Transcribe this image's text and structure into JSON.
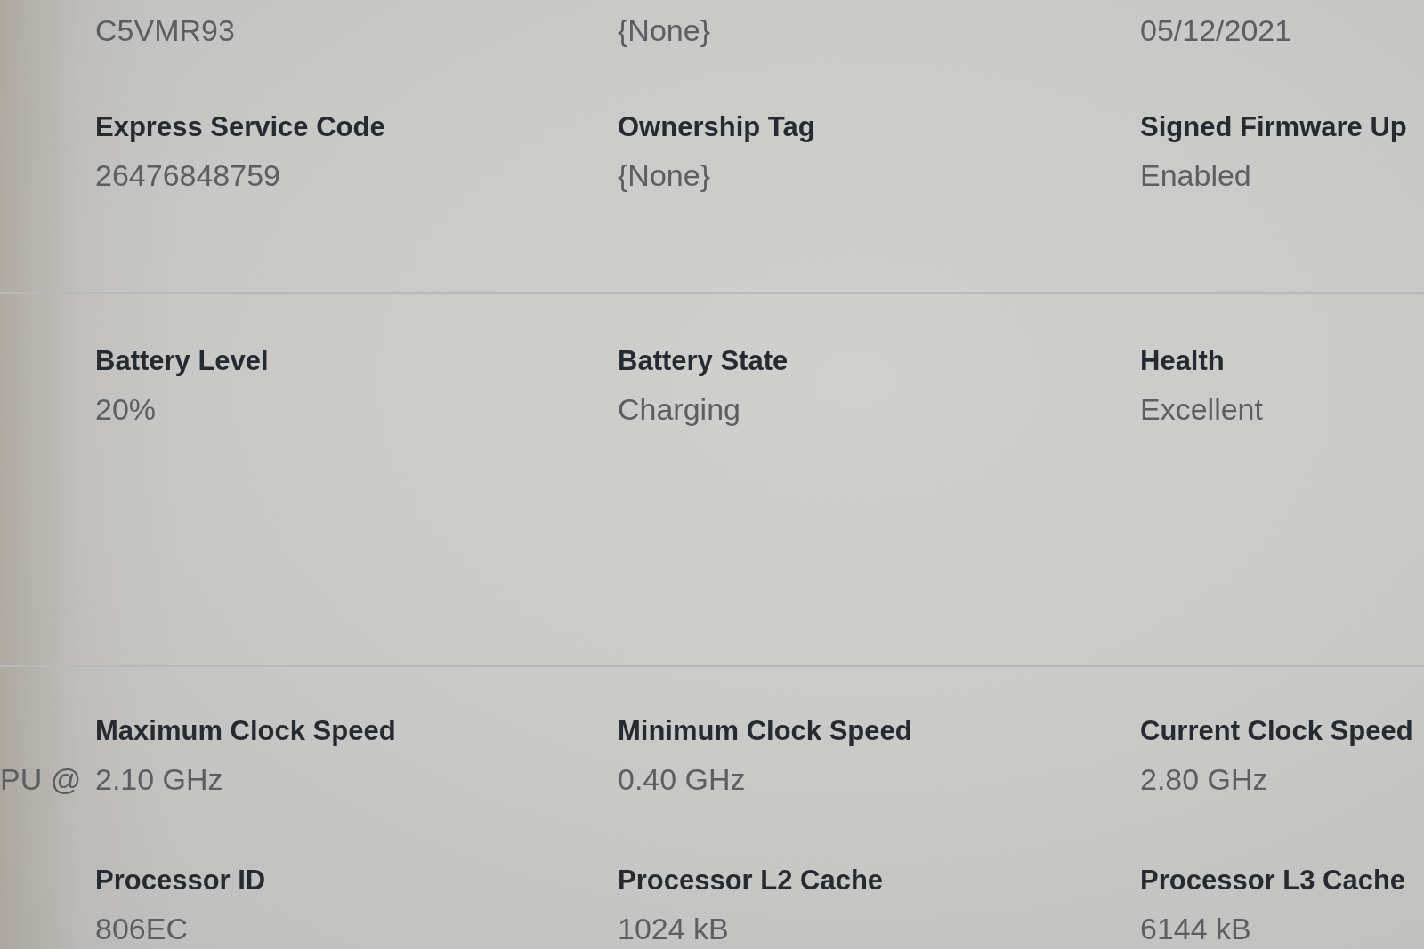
{
  "sections": [
    {
      "rows": [
        {
          "fields": [
            {
              "value": "C5VMR93"
            },
            {
              "value": "{None}"
            },
            {
              "value": "05/12/2021"
            }
          ]
        },
        {
          "fields": [
            {
              "label": "Express Service Code",
              "value": "26476848759"
            },
            {
              "label": "Ownership Tag",
              "value": "{None}"
            },
            {
              "label": "Signed Firmware Up",
              "value": "Enabled"
            }
          ]
        }
      ]
    },
    {
      "rows": [
        {
          "fields": [
            {
              "label": "Battery Level",
              "value": "20%"
            },
            {
              "label": "Battery State",
              "value": "Charging"
            },
            {
              "label": "Health",
              "value": "Excellent"
            }
          ]
        }
      ]
    },
    {
      "rows": [
        {
          "leading": "PU @",
          "fields": [
            {
              "label": "Maximum Clock Speed",
              "value": "2.10 GHz"
            },
            {
              "label": "Minimum Clock Speed",
              "value": "0.40 GHz"
            },
            {
              "label": "Current Clock Speed",
              "value": "2.80 GHz"
            }
          ]
        },
        {
          "fields": [
            {
              "label": "Processor ID",
              "value": "806EC"
            },
            {
              "label": "Processor L2 Cache",
              "value": "1024 kB"
            },
            {
              "label": "Processor L3 Cache",
              "value": "6144 kB"
            }
          ]
        }
      ]
    }
  ]
}
